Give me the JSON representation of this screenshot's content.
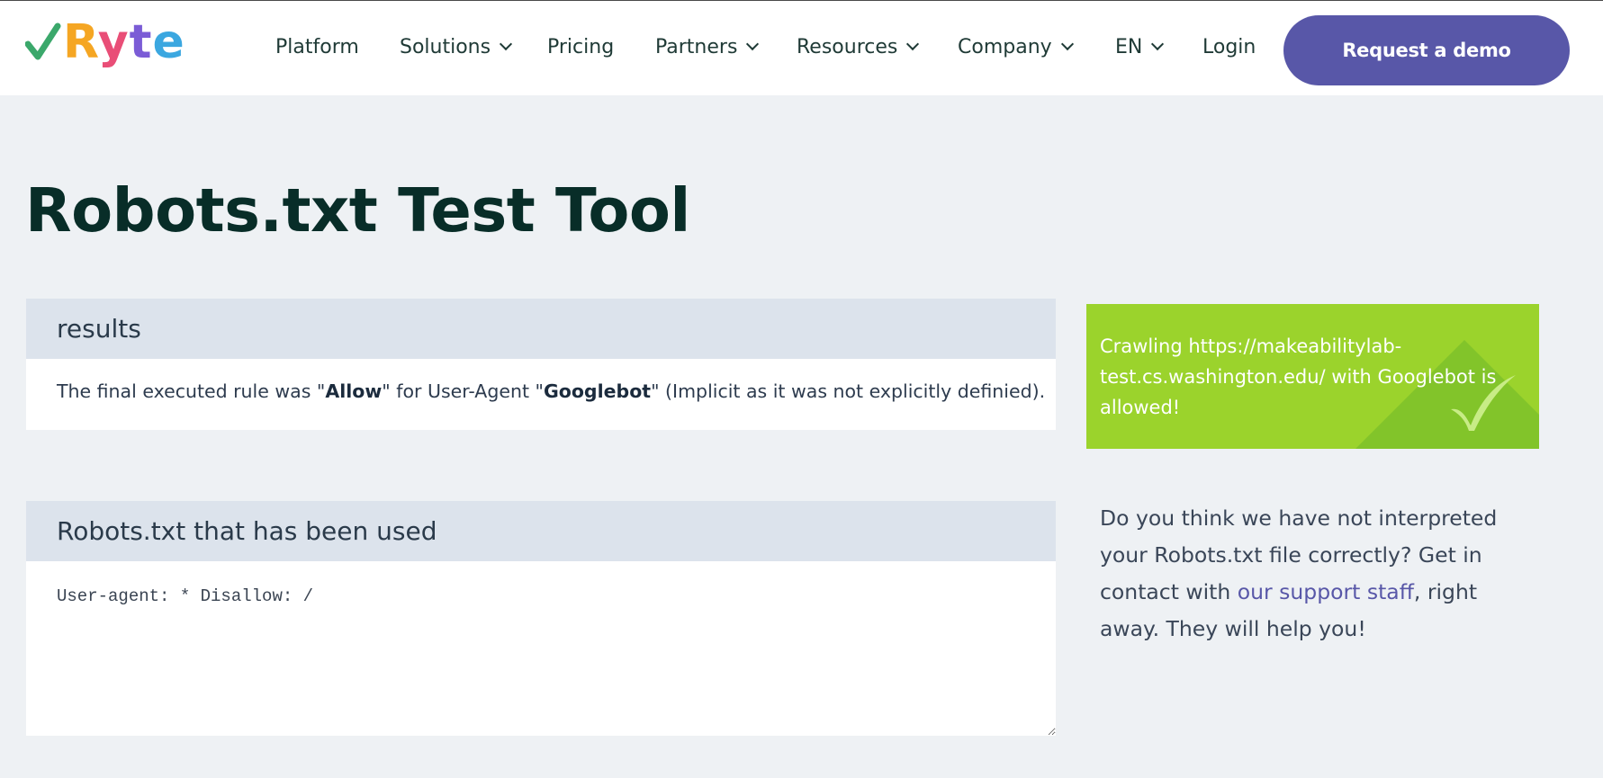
{
  "brand": {
    "name": "Ryte",
    "letters": [
      "R",
      "y",
      "t",
      "e"
    ]
  },
  "nav": {
    "items": [
      {
        "label": "Platform",
        "has_dropdown": false
      },
      {
        "label": "Solutions",
        "has_dropdown": true
      },
      {
        "label": "Pricing",
        "has_dropdown": false
      },
      {
        "label": "Partners",
        "has_dropdown": true
      },
      {
        "label": "Resources",
        "has_dropdown": true
      },
      {
        "label": "Company",
        "has_dropdown": true
      },
      {
        "label": "EN",
        "has_dropdown": true
      },
      {
        "label": "Login",
        "has_dropdown": false
      }
    ],
    "cta_label": "Request a demo"
  },
  "page": {
    "title": "Robots.txt Test Tool"
  },
  "results": {
    "heading": "results",
    "sentence_prefix": "The final executed rule was \"",
    "rule": "Allow",
    "sentence_middle": "\" for User-Agent \"",
    "user_agent": "Googlebot",
    "sentence_suffix": "\" (Implicit as it was not explicitly definied)."
  },
  "robots": {
    "heading": "Robots.txt that has been used",
    "content": "User-agent: * Disallow: /"
  },
  "status": {
    "message": "Crawling https://makeabilitylab-test.cs.washington.edu/ with Googlebot is allowed!",
    "color": "#9bd32c"
  },
  "help": {
    "text_before": "Do you think we have not interpreted your Robots.txt file correctly? Get in contact with ",
    "link_label": "our support staff",
    "text_after": ", right away. They will help you!"
  },
  "colors": {
    "accent": "#5857a8",
    "title": "#082d28",
    "background": "#eef1f4",
    "panel_header": "#dce3ec"
  }
}
